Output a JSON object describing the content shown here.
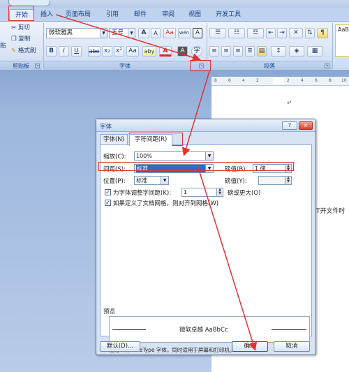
{
  "tabs": [
    {
      "label": "开始",
      "active": true
    },
    {
      "label": "插入",
      "active": false
    },
    {
      "label": "页面布局",
      "active": false
    },
    {
      "label": "引用",
      "active": false
    },
    {
      "label": "邮件",
      "active": false
    },
    {
      "label": "审阅",
      "active": false
    },
    {
      "label": "视图",
      "active": false
    },
    {
      "label": "开发工具",
      "active": false
    }
  ],
  "clipboard": {
    "paste_label": "贴",
    "cut": "剪切",
    "copy": "复制",
    "format_painter": "格式刷",
    "group_label": "剪贴板"
  },
  "font_group": {
    "font_name": "微软雅黑",
    "font_size": "五号",
    "grow": "A",
    "shrink": "A",
    "clear_format": "Aa",
    "phonetic": "wén",
    "char_border": "A",
    "bold": "B",
    "italic": "I",
    "underline": "U",
    "strikethrough": "abe",
    "subscript": "x₂",
    "superscript": "x²",
    "change_case": "Aa",
    "highlight": "aby",
    "font_color": "A",
    "char_shading": "A",
    "enclose": "字",
    "group_label": "字体"
  },
  "paragraph_group": {
    "group_label": "段落"
  },
  "styles_group": {
    "sample": "AaBb"
  },
  "ruler": {
    "ticks": [
      "8",
      "6",
      "4",
      "2",
      "",
      "2",
      "4",
      "6",
      "8",
      "10"
    ]
  },
  "document": {
    "mark": "↵",
    "side_text": "T开文件时"
  },
  "dialog": {
    "title": "字体",
    "help": "?",
    "close": "×",
    "tab_font": "字体(N)",
    "tab_spacing": "字符间距(R)",
    "scale_label": "缩放(C):",
    "scale_value": "100%",
    "spacing_label": "间距(S):",
    "spacing_value": "标准",
    "spacing_by_label": "磅值(B):",
    "spacing_by_value": "1 磅",
    "position_label": "位置(P):",
    "position_value": "标准",
    "position_by_label": "磅值(Y):",
    "position_by_value": "",
    "kerning_label": "为字体调整字间距(K):",
    "kerning_value": "1",
    "kerning_suffix": "磅或更大(O)",
    "grid_label": "如果定义了文档网格，则对齐到网格(W)",
    "preview_title": "预览",
    "preview_text": "微软卓越 AaBbCc",
    "preview_note": "这是一种 TrueType 字体，同时适用于屏幕和打印机。",
    "default_button": "默认(D)...",
    "ok_button": "确定",
    "cancel_button": "取消"
  },
  "annotation_color": "#e23232"
}
